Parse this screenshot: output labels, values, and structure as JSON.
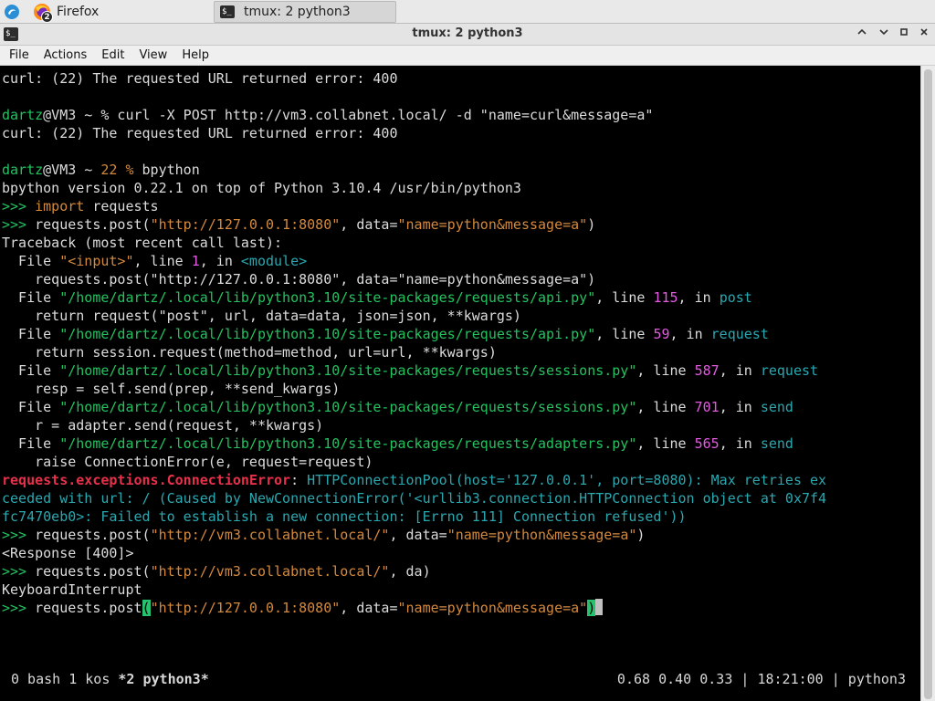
{
  "taskbar": {
    "badge_count": "2",
    "firefox_label": "Firefox",
    "tmux_label": "tmux: 2 python3"
  },
  "window": {
    "title": "tmux: 2 python3",
    "menu": [
      "File",
      "Actions",
      "Edit",
      "View",
      "Help"
    ]
  },
  "terminal": {
    "lines": [
      [
        {
          "t": "curl: (22) The requested URL returned error: 400",
          "c": "w"
        }
      ],
      [],
      [
        {
          "t": "dartz",
          "c": "g"
        },
        {
          "t": "@VM3 ~ % curl -X POST http://vm3.collabnet.local/ -d \"name=curl&message=a\"",
          "c": "w"
        }
      ],
      [
        {
          "t": "curl: (22) The requested URL returned error: 400",
          "c": "w"
        }
      ],
      [],
      [
        {
          "t": "dartz",
          "c": "g"
        },
        {
          "t": "@VM3 ~ ",
          "c": "w"
        },
        {
          "t": "22 %",
          "c": "o"
        },
        {
          "t": " bpython",
          "c": "w"
        }
      ],
      [
        {
          "t": "bpython version 0.22.1 on top of Python 3.10.4 /usr/bin/python3",
          "c": "w"
        }
      ],
      [
        {
          "t": ">>> ",
          "c": "g"
        },
        {
          "t": "import",
          "c": "o"
        },
        {
          "t": " requests",
          "c": "w"
        }
      ],
      [
        {
          "t": ">>> ",
          "c": "g"
        },
        {
          "t": "requests.post(",
          "c": "w"
        },
        {
          "t": "\"http://127.0.0.1:8080\"",
          "c": "o"
        },
        {
          "t": ", data=",
          "c": "w"
        },
        {
          "t": "\"name=python&message=a\"",
          "c": "o"
        },
        {
          "t": ")",
          "c": "w"
        }
      ],
      [
        {
          "t": "Traceback (most recent call last):",
          "c": "w"
        }
      ],
      [
        {
          "t": "  File ",
          "c": "w"
        },
        {
          "t": "\"<input>\"",
          "c": "o"
        },
        {
          "t": ", line ",
          "c": "w"
        },
        {
          "t": "1",
          "c": "m"
        },
        {
          "t": ", in ",
          "c": "w"
        },
        {
          "t": "<module>",
          "c": "t"
        }
      ],
      [
        {
          "t": "    requests.post(\"http://127.0.0.1:8080\", data=\"name=python&message=a\")",
          "c": "w"
        }
      ],
      [
        {
          "t": "  File ",
          "c": "w"
        },
        {
          "t": "\"/home/dartz/.local/lib/python3.10/site-packages/requests/api.py\"",
          "c": "g"
        },
        {
          "t": ", line ",
          "c": "w"
        },
        {
          "t": "115",
          "c": "m"
        },
        {
          "t": ", in ",
          "c": "w"
        },
        {
          "t": "post",
          "c": "t"
        }
      ],
      [
        {
          "t": "    return request(\"post\", url, data=data, json=json, **kwargs)",
          "c": "w"
        }
      ],
      [
        {
          "t": "  File ",
          "c": "w"
        },
        {
          "t": "\"/home/dartz/.local/lib/python3.10/site-packages/requests/api.py\"",
          "c": "g"
        },
        {
          "t": ", line ",
          "c": "w"
        },
        {
          "t": "59",
          "c": "m"
        },
        {
          "t": ", in ",
          "c": "w"
        },
        {
          "t": "request",
          "c": "t"
        }
      ],
      [
        {
          "t": "    return session.request(method=method, url=url, **kwargs)",
          "c": "w"
        }
      ],
      [
        {
          "t": "  File ",
          "c": "w"
        },
        {
          "t": "\"/home/dartz/.local/lib/python3.10/site-packages/requests/sessions.py\"",
          "c": "g"
        },
        {
          "t": ", line ",
          "c": "w"
        },
        {
          "t": "587",
          "c": "m"
        },
        {
          "t": ", in ",
          "c": "w"
        },
        {
          "t": "request",
          "c": "t"
        }
      ],
      [
        {
          "t": "    resp = self.send(prep, **send_kwargs)",
          "c": "w"
        }
      ],
      [
        {
          "t": "  File ",
          "c": "w"
        },
        {
          "t": "\"/home/dartz/.local/lib/python3.10/site-packages/requests/sessions.py\"",
          "c": "g"
        },
        {
          "t": ", line ",
          "c": "w"
        },
        {
          "t": "701",
          "c": "m"
        },
        {
          "t": ", in ",
          "c": "w"
        },
        {
          "t": "send",
          "c": "t"
        }
      ],
      [
        {
          "t": "    r = adapter.send(request, **kwargs)",
          "c": "w"
        }
      ],
      [
        {
          "t": "  File ",
          "c": "w"
        },
        {
          "t": "\"/home/dartz/.local/lib/python3.10/site-packages/requests/adapters.py\"",
          "c": "g"
        },
        {
          "t": ", line ",
          "c": "w"
        },
        {
          "t": "565",
          "c": "m"
        },
        {
          "t": ", in ",
          "c": "w"
        },
        {
          "t": "send",
          "c": "t"
        }
      ],
      [
        {
          "t": "    raise ConnectionError(e, request=request)",
          "c": "w"
        }
      ],
      [
        {
          "t": "requests.exceptions.ConnectionError",
          "c": "r"
        },
        {
          "t": ": ",
          "c": "w"
        },
        {
          "t": "HTTPConnectionPool(host='127.0.0.1', port=8080): Max retries ex",
          "c": "t"
        }
      ],
      [
        {
          "t": "ceeded with url: / (Caused by NewConnectionError('<urllib3.connection.HTTPConnection object at 0x7f4",
          "c": "t"
        }
      ],
      [
        {
          "t": "fc7470eb0>: Failed to establish a new connection: [Errno 111] Connection refused'))",
          "c": "t"
        }
      ],
      [
        {
          "t": ">>> ",
          "c": "g"
        },
        {
          "t": "requests.post(",
          "c": "w"
        },
        {
          "t": "\"http://vm3.collabnet.local/\"",
          "c": "o"
        },
        {
          "t": ", data=",
          "c": "w"
        },
        {
          "t": "\"name=python&message=a\"",
          "c": "o"
        },
        {
          "t": ")",
          "c": "w"
        }
      ],
      [
        {
          "t": "<Response [400]>",
          "c": "w"
        }
      ],
      [
        {
          "t": ">>> ",
          "c": "g"
        },
        {
          "t": "requests.post(",
          "c": "w"
        },
        {
          "t": "\"http://vm3.collabnet.local/\"",
          "c": "o"
        },
        {
          "t": ", da)",
          "c": "w"
        }
      ],
      [
        {
          "t": "KeyboardInterrupt",
          "c": "w"
        }
      ],
      [
        {
          "t": ">>> ",
          "c": "g"
        },
        {
          "t": "requests.post",
          "c": "w"
        },
        {
          "t": "(",
          "c": "cur-paren"
        },
        {
          "t": "\"http://127.0.0.1:8080\"",
          "c": "o"
        },
        {
          "t": ", data=",
          "c": "w"
        },
        {
          "t": "\"name=python&message=a\"",
          "c": "o"
        },
        {
          "t": ")",
          "c": "cur-paren"
        }
      ]
    ],
    "status_left": "0 bash 1 kos ",
    "status_active": "*2 python3*",
    "status_right": "0.68 0.40 0.33 | 18:21:00 | python3"
  }
}
